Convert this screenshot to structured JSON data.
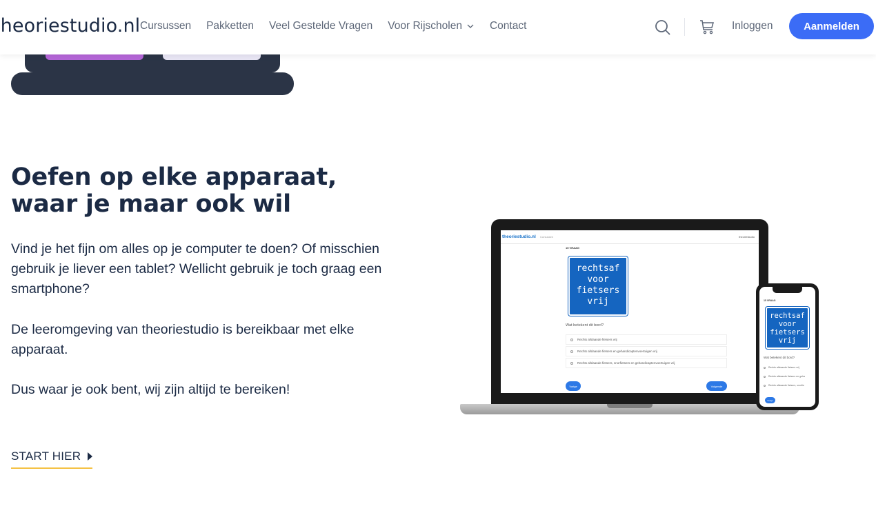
{
  "header": {
    "logo": "theoriestudio.nl",
    "nav": [
      {
        "label": "Cursussen"
      },
      {
        "label": "Pakketten"
      },
      {
        "label": "Veel Gestelde Vragen"
      },
      {
        "label": "Voor Rijscholen",
        "has_dropdown": true
      },
      {
        "label": "Contact"
      }
    ],
    "login": "Inloggen",
    "signup": "Aanmelden"
  },
  "main": {
    "heading": "Oefen op elke apparaat, waar je maar ook wil",
    "paragraphs": [
      "Vind je het fijn om alles op je computer te doen? Of misschien gebruik je liever een tablet? Wellicht gebruik je toch graag een smartphone?",
      "De leeromgeving van theoriestudio is bereikbaar met elke apparaat.",
      "Dus waar je ook bent, wij zijn altijd te bereiken!"
    ],
    "cta": "START HIER"
  },
  "mockup": {
    "laptop": {
      "logo": "theoriestudio.nl",
      "menu": "Cursussen",
      "right": "theoriestudio",
      "label": "15 VRAAG",
      "sign": [
        "rechtsaf",
        "voor",
        "fietsers",
        "vrij"
      ],
      "question": "Wat betekent dit bord?",
      "options": [
        "Rechts afslaande fietsers vrij",
        "Rechts afslaande fietsers en gehandicaptenvoertuigen vrij",
        "Rechts afslaande fietsers, snorfietsers en gehandicaptenvoertuigen vrij"
      ],
      "prev": "Vorige",
      "next": "Volgende"
    },
    "phone": {
      "label": "15 VRAAG",
      "sign": [
        "rechtsaf",
        "voor",
        "fietsers",
        "vrij"
      ],
      "question": "Wat betekent dit bord?",
      "options": [
        "Rechts afslaande fietsers vrij",
        "Rechts afslaande fietsers en geha",
        "Rechts afslaande fietsers, snorfie"
      ],
      "prev": "Vorige"
    }
  },
  "colors": {
    "primary": "#3b6cf6",
    "heading": "#1b2a44",
    "cta_underline": "#f5c244",
    "illustration_dark": "#2b3446",
    "sign_blue": "#1565c0"
  }
}
